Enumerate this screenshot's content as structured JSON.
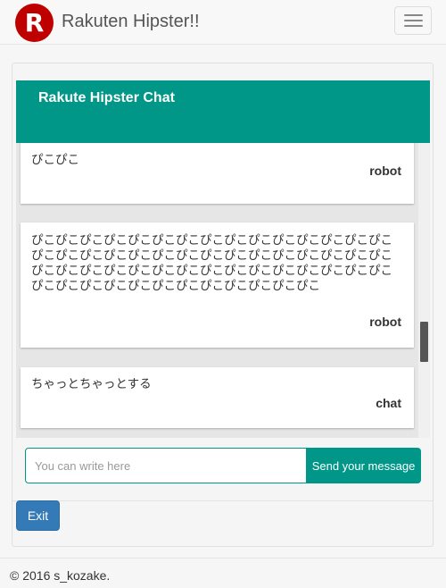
{
  "navbar": {
    "logo_letter": "R",
    "brand": "Rakuten Hipster!!"
  },
  "chat": {
    "title": "Rakute Hipster Chat",
    "messages": [
      {
        "text": "ぴこぴこ",
        "author": "robot"
      },
      {
        "text": "ぴこぴこぴこぴこぴこぴこぴこぴこぴこぴこぴこぴこぴこぴこぴこぴこぴこぴこぴこぴこぴこぴこぴこぴこぴこぴこぴこぴこぴこぴこぴこぴこぴこぴこぴこぴこぴこぴこぴこぴこぴこぴこぴこぴこぴこぴこぴこぴこぴこぴこぴこぴこぴこぴこぴこぴこぴこ",
        "author": "robot"
      },
      {
        "text": "ちゃっとちゃっとする",
        "author": "chat"
      }
    ]
  },
  "composer": {
    "placeholder": "You can write here",
    "value": "",
    "send_label": "Send your message"
  },
  "exit_label": "Exit",
  "footer_text": "© 2016 s_kozake.",
  "colors": {
    "accent": "#009688",
    "primary_button": "#337ab7",
    "logo": "#bf0000"
  }
}
